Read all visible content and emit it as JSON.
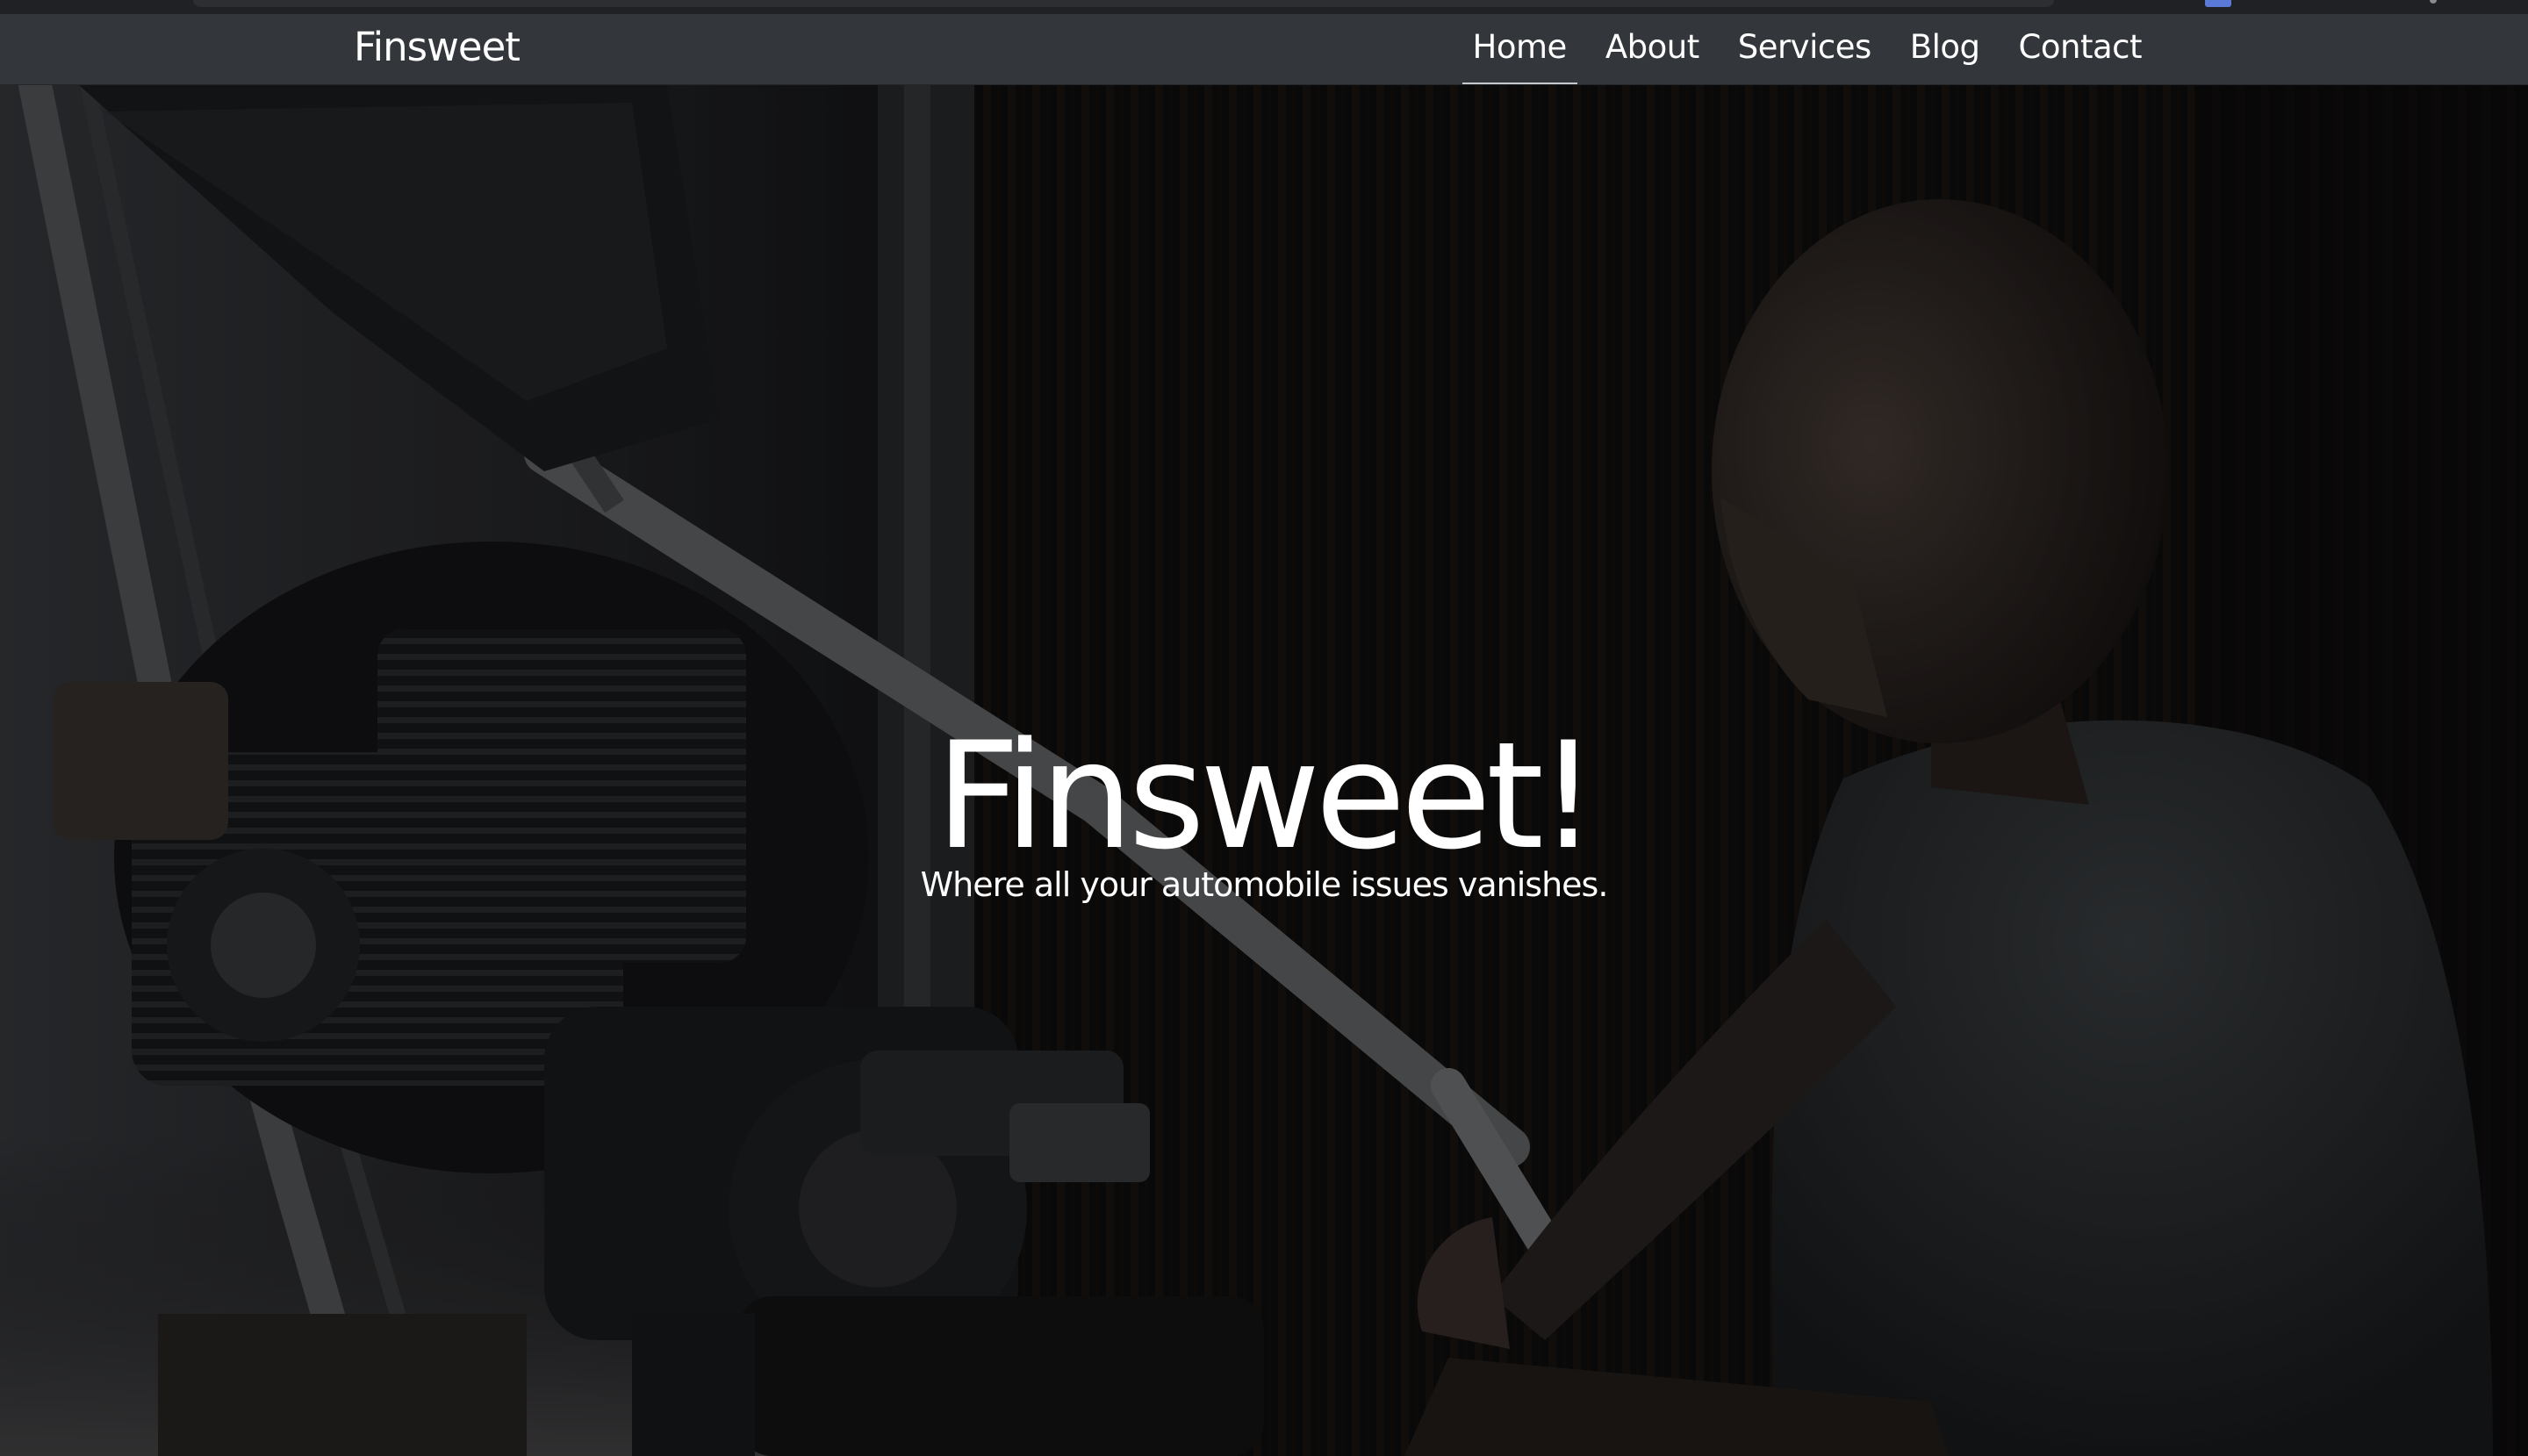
{
  "navbar": {
    "brand": "Finsweet",
    "links": [
      {
        "label": "Home",
        "active": true
      },
      {
        "label": "About",
        "active": false
      },
      {
        "label": "Services",
        "active": false
      },
      {
        "label": "Blog",
        "active": false
      },
      {
        "label": "Contact",
        "active": false
      }
    ]
  },
  "hero": {
    "title": "Finsweet!",
    "subtitle": "Where all your automobile issues vanishes.",
    "background_image": "mechanic-working-on-motorcycle-engine"
  },
  "colors": {
    "navbar_bg": "#33373c",
    "text": "#ffffff",
    "hero_bg": "#0d0e10"
  }
}
